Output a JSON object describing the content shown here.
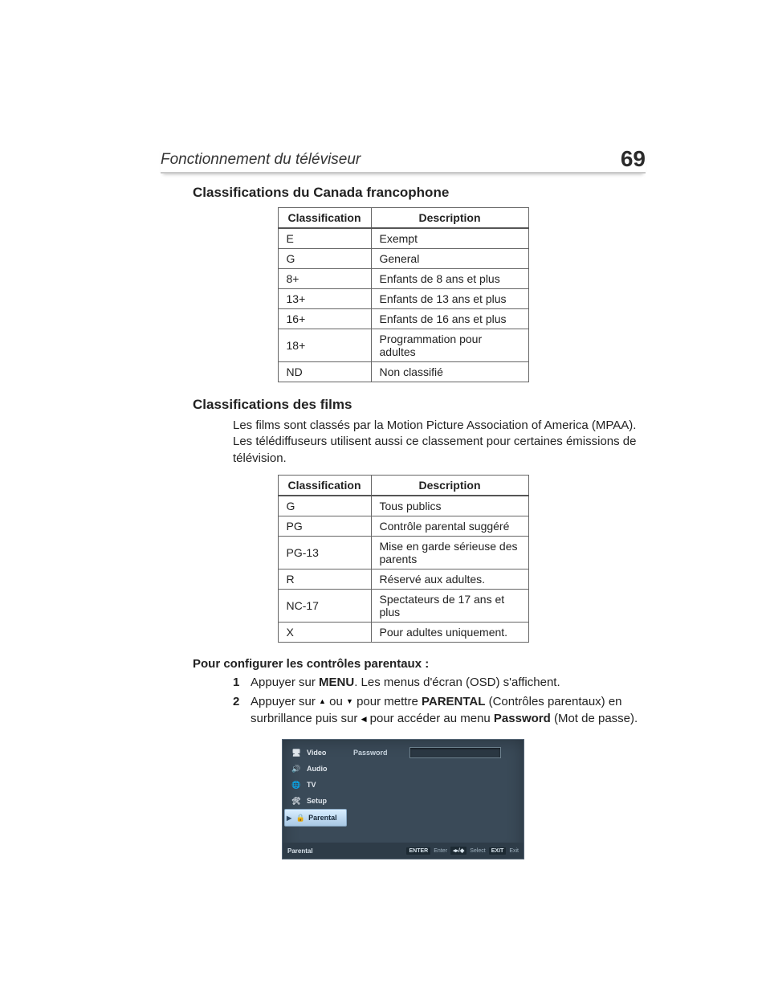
{
  "header": {
    "title": "Fonctionnement du téléviseur",
    "page_number": "69"
  },
  "section1": {
    "heading": "Classifications du Canada francophone",
    "table": {
      "col1": "Classification",
      "col2": "Description",
      "rows": [
        {
          "c": "E",
          "d": "Exempt"
        },
        {
          "c": "G",
          "d": "General"
        },
        {
          "c": "8+",
          "d": "Enfants de 8 ans et plus"
        },
        {
          "c": "13+",
          "d": "Enfants de 13 ans et plus"
        },
        {
          "c": "16+",
          "d": "Enfants de 16 ans et plus"
        },
        {
          "c": "18+",
          "d": "Programmation pour adultes"
        },
        {
          "c": "ND",
          "d": "Non classifié"
        }
      ]
    }
  },
  "section2": {
    "heading": "Classifications des films",
    "intro": "Les films sont classés par la Motion Picture Association of America (MPAA). Les télédiffuseurs utilisent aussi ce classement pour certaines émissions de télévision.",
    "table": {
      "col1": "Classification",
      "col2": "Description",
      "rows": [
        {
          "c": "G",
          "d": "Tous publics"
        },
        {
          "c": "PG",
          "d": "Contrôle parental suggéré"
        },
        {
          "c": "PG-13",
          "d": "Mise en garde sérieuse des parents"
        },
        {
          "c": "R",
          "d": "Réservé aux adultes."
        },
        {
          "c": "NC-17",
          "d": "Spectateurs de 17 ans et plus"
        },
        {
          "c": "X",
          "d": "Pour adultes uniquement."
        }
      ]
    }
  },
  "instructions": {
    "title": "Pour configurer les contrôles parentaux :",
    "step1": {
      "num": "1",
      "pre": "Appuyer sur ",
      "menu": "MENU",
      "post": ". Les menus d'écran (OSD) s'affichent."
    },
    "step2": {
      "num": "2",
      "a": "Appuyer sur ",
      "b": " ou ",
      "c": " pour mettre ",
      "parental": "PARENTAL",
      "d": " (Contrôles parentaux) en surbrillance puis sur ",
      "e": " pour accéder au menu ",
      "password": "Password",
      "f": " (Mot de passe)."
    }
  },
  "osd": {
    "menu": {
      "video": "Video",
      "audio": "Audio",
      "tv": "TV",
      "setup": "Setup",
      "parental": "Parental"
    },
    "field_label": "Password",
    "footer": {
      "crumb": "Parental",
      "enter_tag": "ENTER",
      "enter_txt": "Enter",
      "select_sym": "◂▸/◆",
      "select_txt": "Select",
      "exit_tag": "EXIT",
      "exit_txt": "Exit"
    }
  }
}
